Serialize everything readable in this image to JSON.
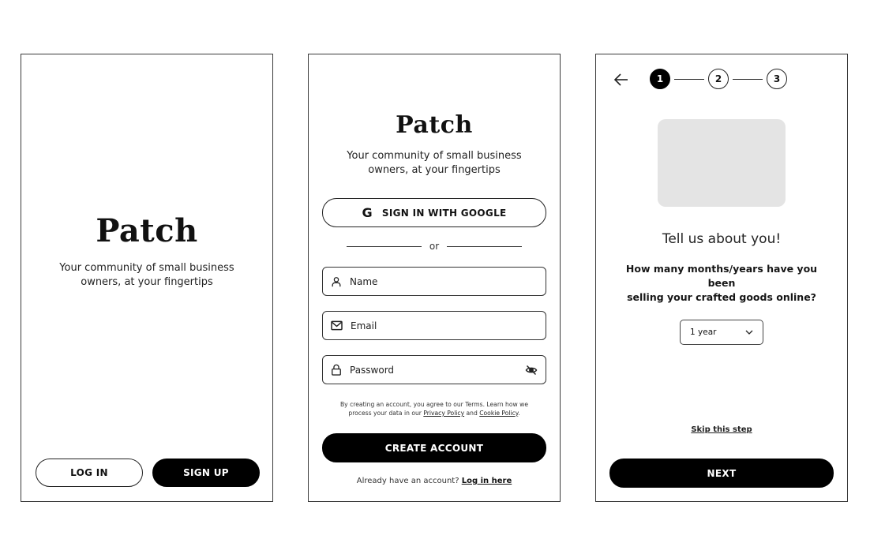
{
  "screens": {
    "welcome": {
      "logo": "Patch",
      "tagline_line1": "Your community of small business",
      "tagline_line2": "owners, at your fingertips",
      "login_label": "LOG IN",
      "signup_label": "SIGN UP"
    },
    "signup": {
      "logo": "Patch",
      "tagline_line1": "Your community of small business",
      "tagline_line2": "owners, at your fingertips",
      "google_icon": "G",
      "google_label": "SIGN IN WITH GOOGLE",
      "divider_text": "or",
      "fields": {
        "name": {
          "placeholder": "Name",
          "value": "",
          "icon": "user-icon"
        },
        "email": {
          "placeholder": "Email",
          "value": "",
          "icon": "mail-icon"
        },
        "password": {
          "placeholder": "Password",
          "value": "",
          "icon": "lock-icon",
          "toggle_icon": "eye-off-icon"
        }
      },
      "terms": {
        "line1": "By creating an account, you agree to our Terms. Learn how we",
        "line2_prefix": "process your data in our",
        "privacy_link": "Privacy Policy",
        "and": "and",
        "cookie_link": "Cookie Policy",
        "period": "."
      },
      "create_label": "CREATE ACCOUNT",
      "already_text": "Already have an account?",
      "login_link": "Log in here"
    },
    "onboarding": {
      "back_icon": "arrow-left-icon",
      "steps": [
        {
          "label": "1",
          "active": true
        },
        {
          "label": "2",
          "active": false
        },
        {
          "label": "3",
          "active": false
        }
      ],
      "title": "Tell us about you!",
      "question_line1": "How many months/years have you been",
      "question_line2": "selling your crafted goods online?",
      "select_value": "1 year",
      "skip_label": "Skip this step",
      "next_label": "NEXT"
    }
  }
}
